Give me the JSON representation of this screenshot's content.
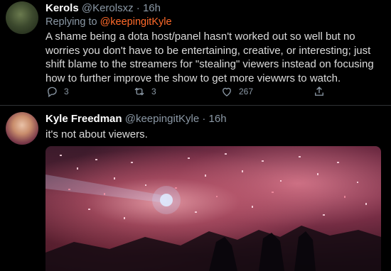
{
  "tweet1": {
    "name": "Kerols",
    "handle": "@Kerolsxz",
    "dot": "·",
    "time": "16h",
    "replying_prefix": "Replying to ",
    "replying_handle": "@keepingitKyle",
    "text_lines": [
      "A shame being a dota host/panel hasn't worked out so well but no",
      "worries you don't have to be entertaining, creative, or interesting; just",
      "shift blame to the streamers for \"stealing\" viewers instead on focusing",
      "how to further improve the show to get more viewwrs to watch."
    ],
    "actions": {
      "reply_icon": "reply-icon",
      "reply_count": "3",
      "retweet_icon": "retweet-icon",
      "retweet_count": "3",
      "like_icon": "heart-icon",
      "like_count": "267",
      "share_icon": "share-icon"
    }
  },
  "tweet2": {
    "name": "Kyle Freedman",
    "handle": "@keepingitKyle",
    "dot": "·",
    "time": "16h",
    "text": "it's not about viewers.",
    "media_icon": "photo-confetti-stage"
  },
  "colors": {
    "background": "#000000",
    "secondary_text": "#8b98a5",
    "mention_accent": "#ff6a2a",
    "name_text": "#ffffff"
  }
}
